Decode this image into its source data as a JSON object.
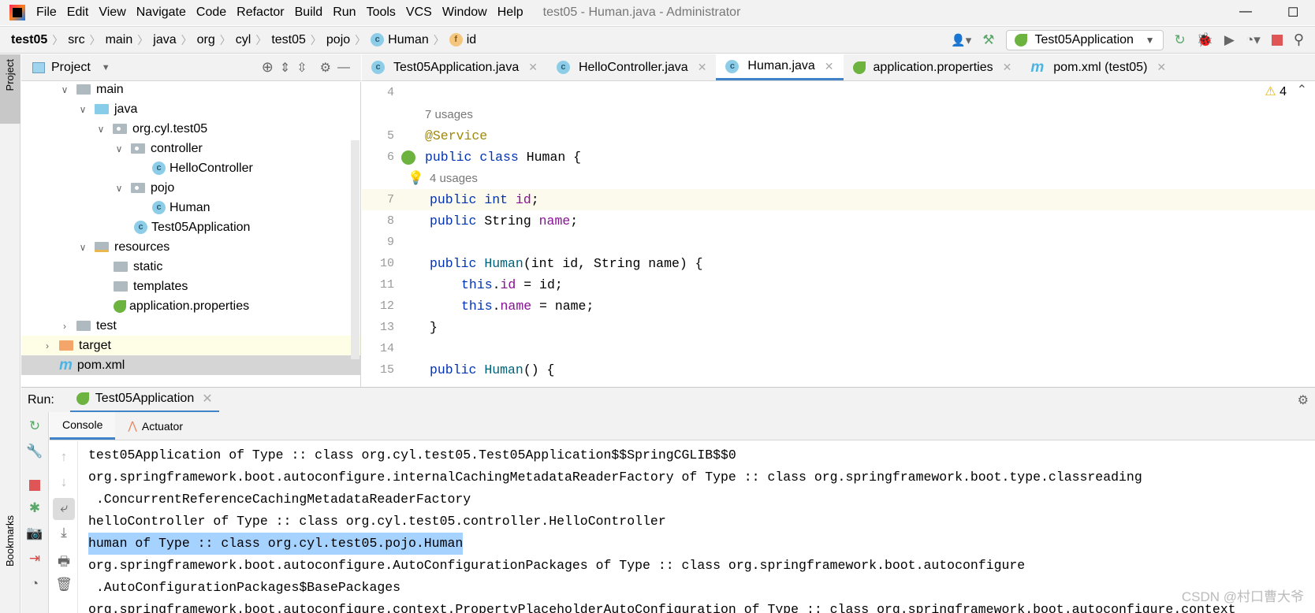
{
  "menu": {
    "items": [
      "File",
      "Edit",
      "View",
      "Navigate",
      "Code",
      "Refactor",
      "Build",
      "Run",
      "Tools",
      "VCS",
      "Window",
      "Help"
    ],
    "title": "test05 - Human.java - Administrator"
  },
  "breadcrumb": [
    "test05",
    "src",
    "main",
    "java",
    "org",
    "cyl",
    "test05",
    "pojo",
    "Human",
    "id"
  ],
  "toolbar": {
    "run_config": "Test05Application"
  },
  "project": {
    "title": "Project",
    "tree": [
      "main",
      "java",
      "org.cyl.test05",
      "controller",
      "HelloController",
      "pojo",
      "Human",
      "Test05Application",
      "resources",
      "static",
      "templates",
      "application.properties",
      "test",
      "target",
      "pom.xml"
    ]
  },
  "stripe": {
    "project": "Project",
    "bookmarks": "Bookmarks"
  },
  "tabs": [
    "Test05Application.java",
    "HelloController.java",
    "Human.java",
    "application.properties",
    "pom.xml (test05)"
  ],
  "editor": {
    "warnings": "4",
    "usages1": "7 usages",
    "usages2": "4 usages",
    "lines": [
      {
        "n": "4"
      },
      {
        "n": "5",
        "t": "@Service"
      },
      {
        "n": "6"
      },
      {
        "n": "7"
      },
      {
        "n": "8"
      },
      {
        "n": "9"
      },
      {
        "n": "10"
      },
      {
        "n": "11"
      },
      {
        "n": "12"
      },
      {
        "n": "13"
      },
      {
        "n": "14"
      },
      {
        "n": "15"
      }
    ],
    "tok": {
      "public": "public",
      "class": "class",
      "int": "int",
      "string": "String",
      "human": "Human",
      "id": "id",
      "name": "name",
      "this": "this",
      "brace_open": "{",
      "brace_close": "}",
      "human_decl": " Human {",
      "semi": ";",
      "eq": " = ",
      "ctor_params": "(int id, String name) {",
      "empty_ctor": "() {"
    }
  },
  "run": {
    "label": "Run:",
    "config": "Test05Application",
    "tabs": [
      "Console",
      "Actuator"
    ]
  },
  "console": [
    "test05Application of Type :: class org.cyl.test05.Test05Application$$SpringCGLIB$$0",
    "org.springframework.boot.autoconfigure.internalCachingMetadataReaderFactory of Type :: class org.springframework.boot.type.classreading",
    " .ConcurrentReferenceCachingMetadataReaderFactory",
    "helloController of Type :: class org.cyl.test05.controller.HelloController",
    "human of Type :: class org.cyl.test05.pojo.Human",
    "org.springframework.boot.autoconfigure.AutoConfigurationPackages of Type :: class org.springframework.boot.autoconfigure",
    " .AutoConfigurationPackages$BasePackages",
    "org.springframework.boot.autoconfigure.context.PropertyPlaceholderAutoConfiguration of Type :: class org.springframework.boot.autoconfigure.context"
  ],
  "watermark": "CSDN @村口曹大爷"
}
